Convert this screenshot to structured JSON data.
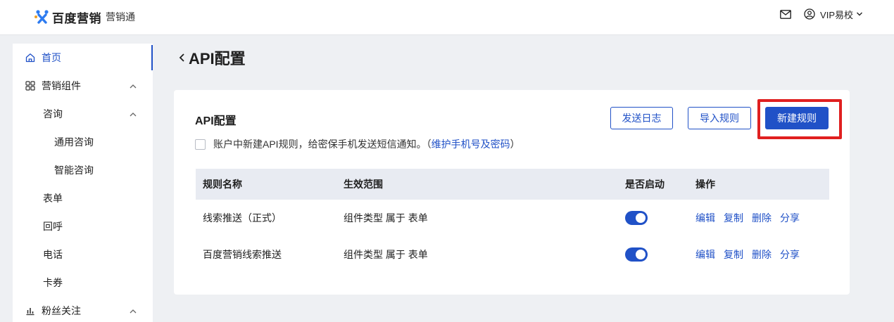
{
  "header": {
    "logo_text": "百度营销",
    "logo_sub": "营销通",
    "user_name": "VIP易校"
  },
  "sidebar": {
    "items": [
      {
        "label": "首页",
        "icon": "home-icon",
        "level": 1,
        "active": true
      },
      {
        "label": "营销组件",
        "icon": "grid-icon",
        "level": 1,
        "expanded": true
      },
      {
        "label": "咨询",
        "level": 2,
        "expanded": true
      },
      {
        "label": "通用咨询",
        "level": 3
      },
      {
        "label": "智能咨询",
        "level": 3
      },
      {
        "label": "表单",
        "level": 2
      },
      {
        "label": "回呼",
        "level": 2
      },
      {
        "label": "电话",
        "level": 2
      },
      {
        "label": "卡券",
        "level": 2
      },
      {
        "label": "粉丝关注",
        "icon": "bar-chart-icon",
        "level": 1,
        "expanded": true
      }
    ]
  },
  "page": {
    "title": "API配置"
  },
  "card": {
    "title": "API配置",
    "buttons": {
      "send_log": "发送日志",
      "import_rules": "导入规则",
      "new_rule": "新建规则"
    },
    "notice": {
      "text": "账户中新建API规则，给密保手机发送短信通知。（",
      "link": "维护手机号及密码",
      "suffix": "）",
      "checked": false
    },
    "table": {
      "columns": [
        "规则名称",
        "生效范围",
        "是否启动",
        "操作"
      ],
      "rows": [
        {
          "name": "线索推送（正式）",
          "scope": "组件类型 属于 表单",
          "enabled": true
        },
        {
          "name": "百度营销线索推送",
          "scope": "组件类型 属于 表单",
          "enabled": true
        }
      ],
      "actions": [
        "编辑",
        "复制",
        "删除",
        "分享"
      ]
    }
  },
  "colors": {
    "accent": "#2051c7",
    "highlight": "#e02020"
  }
}
